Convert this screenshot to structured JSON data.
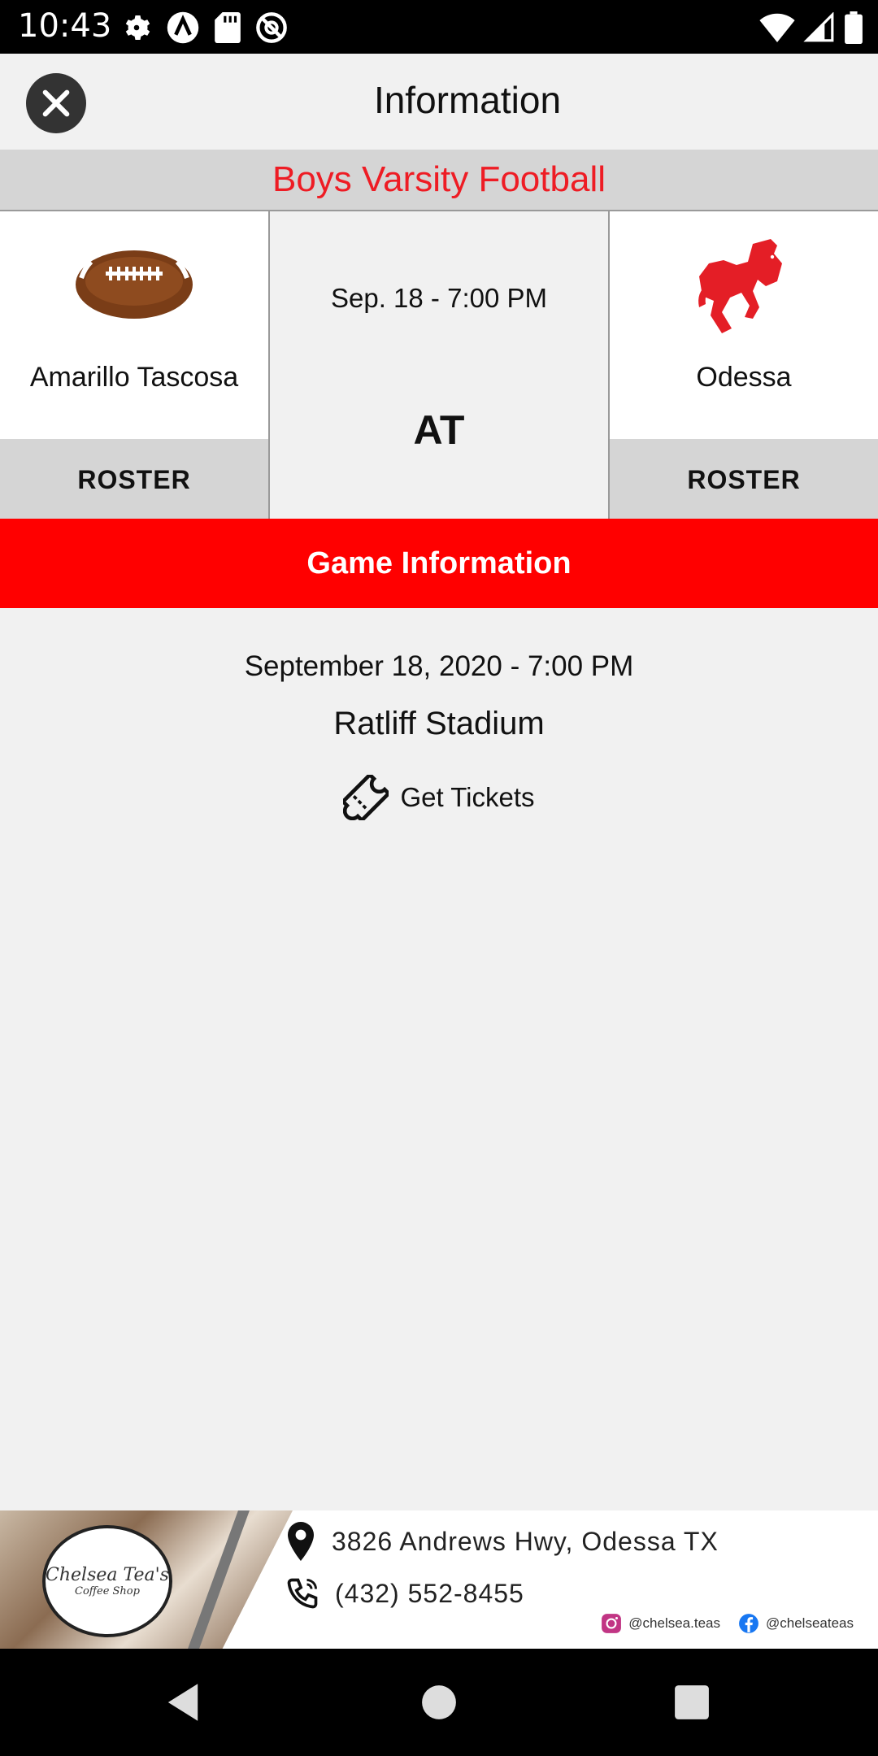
{
  "status_bar": {
    "time": "10:43",
    "left_icons": [
      "gear-icon",
      "arc-icon",
      "sd-card-icon",
      "no-disturb-icon"
    ],
    "right_icons": [
      "wifi-icon",
      "signal-icon",
      "battery-icon"
    ]
  },
  "header": {
    "title": "Information",
    "close_icon": "close-icon"
  },
  "sport": {
    "title": "Boys Varsity Football",
    "color": "#ee1c24"
  },
  "matchup": {
    "home_team": {
      "name": "Amarillo Tascosa",
      "logo_icon": "football-icon",
      "roster_label": "ROSTER"
    },
    "away_team": {
      "name": "Odessa",
      "logo_icon": "bronco-icon",
      "roster_label": "ROSTER"
    },
    "game_date_short": "Sep. 18 - 7:00 PM",
    "separator": "AT"
  },
  "game_info": {
    "title": "Game Information",
    "bar_color": "#ff0000",
    "date_full": "September 18, 2020 - 7:00 PM",
    "venue": "Ratliff Stadium",
    "tickets_label": "Get Tickets",
    "tickets_icon": "ticket-icon"
  },
  "ad": {
    "logo_text": "Chelsea Tea's",
    "logo_subtext": "Coffee Shop",
    "address": "3826 Andrews Hwy, Odessa TX",
    "phone": "(432) 552-8455",
    "instagram": "@chelsea.teas",
    "facebook": "@chelseateas"
  },
  "nav_bar": {
    "buttons": [
      "back-icon",
      "home-icon",
      "recents-icon"
    ]
  }
}
